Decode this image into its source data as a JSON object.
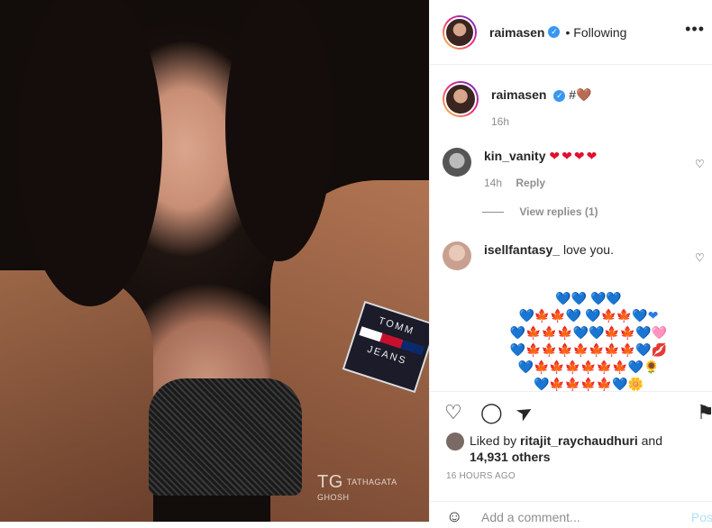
{
  "photo": {
    "watermark_mark": "TG",
    "watermark_text": "TATHAGATA GHOSH",
    "patch_top": "TOMM",
    "patch_bottom": "JEANS"
  },
  "header": {
    "username": "raimasen",
    "verified": "✓",
    "following": "• Following",
    "more": "•••"
  },
  "caption": {
    "username": "raimasen",
    "text": "#🤎",
    "time": "16h"
  },
  "comments": [
    {
      "username": "kin_vanity",
      "text": "❤❤❤❤",
      "time": "14h",
      "reply": "Reply",
      "view_replies": "View replies (1)"
    },
    {
      "username": "isellfantasy_",
      "text": "love you."
    }
  ],
  "emoji_art": [
    "💙💙 💙💙",
    "💙🍁🍁💙 💙🍁🍁💙❤",
    "💙🍁🍁🍁💙💙🍁🍁💙🩷",
    "💙🍁🍁🍁🍁🍁🍁🍁💙💋",
    "💙🍁🍁🍁🍁🍁🍁💙🌻",
    "💙🍁🍁🍁🍁💙🌼"
  ],
  "actions": {
    "like": "♡",
    "comment": "◯",
    "share": "➤",
    "save": "⚑"
  },
  "likes": {
    "prefix": "Liked by",
    "user": "ritajit_raychaudhuri",
    "and": "and",
    "others": "14,931 others"
  },
  "timestamp": "16 HOURS AGO",
  "add_comment": {
    "emoji": "☺",
    "placeholder": "Add a comment...",
    "post": "Pos"
  }
}
